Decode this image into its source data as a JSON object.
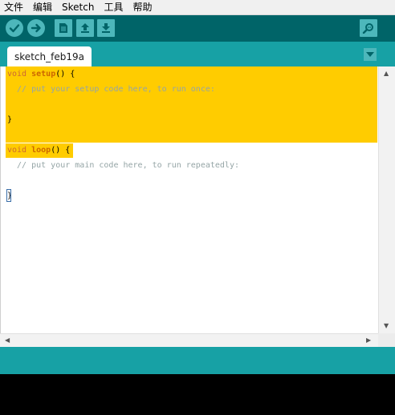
{
  "menubar": {
    "items": [
      "文件",
      "编辑",
      "Sketch",
      "工具",
      "帮助"
    ]
  },
  "toolbar": {
    "buttons": [
      {
        "icon": "verify-check-icon"
      },
      {
        "icon": "upload-arrow-icon"
      },
      {
        "icon": "new-file-icon"
      },
      {
        "icon": "open-up-arrow-icon"
      },
      {
        "icon": "save-down-arrow-icon"
      },
      {
        "icon": "serial-monitor-icon"
      }
    ]
  },
  "tabs": {
    "active_label": "sketch_feb19a"
  },
  "editor": {
    "setup_void": "void",
    "setup_name": "setup",
    "setup_sig_rest": "() {",
    "setup_comment": "  // put your setup code here, to run once:",
    "setup_close": "}",
    "loop_void": "void",
    "loop_name": "loop",
    "loop_sig_rest": "() {",
    "loop_comment": "  // put your main code here, to run repeatedly:",
    "loop_close": "}"
  },
  "colors": {
    "toolbar_bg": "#006468",
    "tabbar_bg": "#17a1a5",
    "button_bg": "#4db7bb",
    "highlight": "#ffcc00",
    "keyword": "#cc6600",
    "comment": "#95a5a6",
    "console_bg": "#000000"
  }
}
